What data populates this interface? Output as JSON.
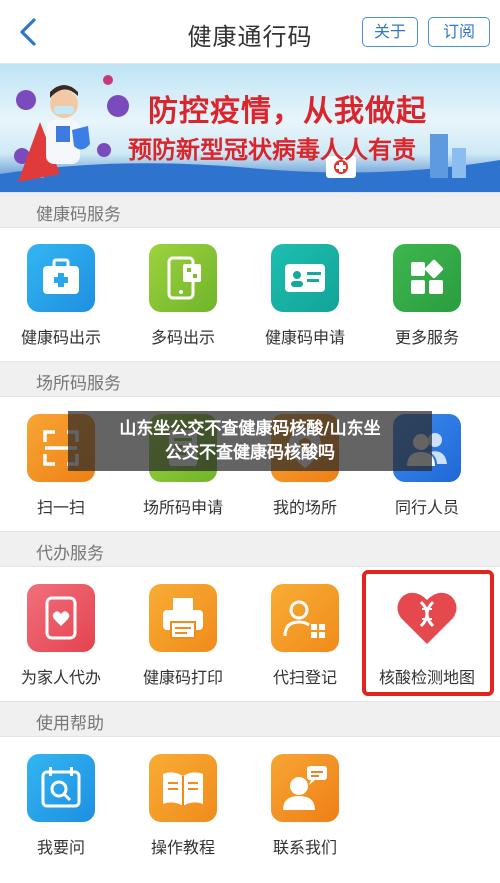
{
  "header": {
    "title": "健康通行码",
    "about_label": "关于",
    "subscribe_label": "订阅"
  },
  "banner": {
    "line1": "防控疫情，从我做起",
    "line2": "预防新型冠状病毒人人有责"
  },
  "sections": {
    "health": {
      "title": "健康码服务",
      "items": [
        "健康码出示",
        "多码出示",
        "健康码申请",
        "更多服务"
      ]
    },
    "place": {
      "title": "场所码服务",
      "items": [
        "扫一扫",
        "场所码申请",
        "我的场所",
        "同行人员"
      ]
    },
    "proxy": {
      "title": "代办服务",
      "items": [
        "为家人代办",
        "健康码打印",
        "代扫登记",
        "核酸检测地图"
      ]
    },
    "help": {
      "title": "使用帮助",
      "items": [
        "我要问",
        "操作教程",
        "联系我们"
      ]
    }
  },
  "overlay": {
    "line1": "山东坐公交不查健康码核酸/山东坐",
    "line2": "公交不查健康码核酸吗"
  },
  "colors": {
    "accent": "#4a90e2",
    "highlight": "#e3241c",
    "slogan": "#d9262c"
  }
}
